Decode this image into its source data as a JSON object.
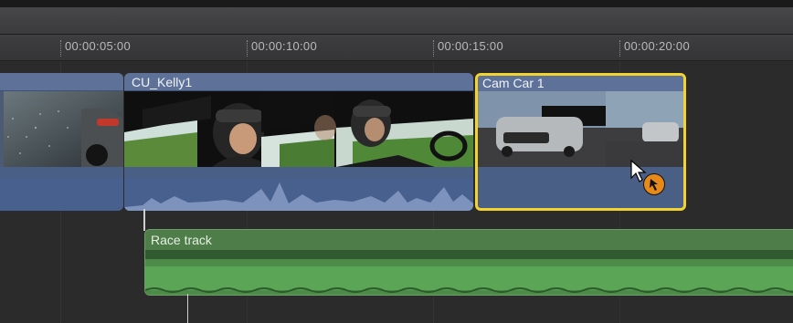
{
  "ruler": {
    "timecodes": [
      "00:00:05:00",
      "00:00:10:00",
      "00:00:15:00",
      "00:00:20:00"
    ]
  },
  "clips": {
    "left_clip": {
      "name": ""
    },
    "cu_kelly": {
      "name": "CU_Kelly1"
    },
    "cam_car": {
      "name": "Cam Car 1",
      "selected": true
    }
  },
  "audio_clip": {
    "name": "Race track"
  },
  "colors": {
    "video_clip": "#5d7199",
    "audio_clip": "#4e7d4a",
    "selection": "#f3d32e"
  },
  "cursor": {
    "icon": "arrow-cursor-icon",
    "badge_icon": "connect-clip-badge-icon"
  }
}
